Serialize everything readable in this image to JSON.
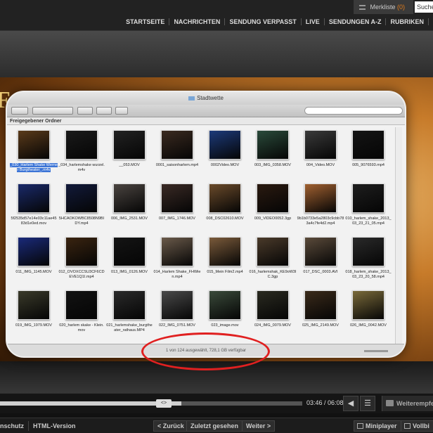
{
  "topbar": {
    "merkliste_label": "Merkliste",
    "merkliste_count": "(0)",
    "search_text": "Suche",
    "nav": [
      "STARTSEITE",
      "NACHRICHTEN",
      "SENDUNG VERPASST",
      "LIVE",
      "SENDUNGEN A-Z",
      "RUBRIKEN",
      "TI"
    ]
  },
  "video": {
    "finder": {
      "title": "Stadtwette",
      "path": "Freigegebener Ordner",
      "files": [
        {
          "name": "_030_Harlem Shake Werner Burgtheater_.m4v",
          "selected": true,
          "color": "#5a3a1a"
        },
        {
          "name": "_034_harlemshake wurzel.m4v",
          "color": "#1a1a1a"
        },
        {
          "name": "__053.MOV",
          "color": "#222"
        },
        {
          "name": "0001_saisonharlem.mp4",
          "color": "#3a2a20"
        },
        {
          "name": "0002Video.MOV",
          "color": "#1c3a7a"
        },
        {
          "name": "003_IMG_0358.MOV",
          "color": "#2a4a3a"
        },
        {
          "name": "004_Video.MOV",
          "color": "#3a3a3a"
        },
        {
          "name": "005_9076593.mp4",
          "color": "#141414"
        },
        {
          "name": "5f2535d57e14e03c11ae4583d1e0ed.mov",
          "color": "#1a2a6a"
        },
        {
          "name": "5HCAOKOWBC8508N9BIDY.mp4",
          "color": "#121a3a"
        },
        {
          "name": "006_IMG_2531.MOV",
          "color": "#4a4440"
        },
        {
          "name": "007_IMG_1746.MOV",
          "color": "#3a2a25"
        },
        {
          "name": "008_DSC02610.MOV",
          "color": "#6a4a2a"
        },
        {
          "name": "009_VIDEO0052.3gp",
          "color": "#2a1a10"
        },
        {
          "name": "9b1b0733e5a2803c9cbb783a4c7fe4d2.mp4",
          "color": "#a06030"
        },
        {
          "name": "010_harlem_shake_2013_03_23_21_05.mp4",
          "color": "#1e1e1e"
        },
        {
          "name": "011_IMG_1145.MOV",
          "color": "#1a2a7a"
        },
        {
          "name": "012_OVOXCCSU3CF6CDEVE1Q1I.mp4",
          "color": "#3a2410"
        },
        {
          "name": "013_IMG_0126.MOV",
          "color": "#141414"
        },
        {
          "name": "014_Harlem Shake_FHWien.mp4",
          "color": "#6a5a4a"
        },
        {
          "name": "015_Mein Film2.mp4",
          "color": "#7a5a3a"
        },
        {
          "name": "016_harlemshak_KE9oW3IC.3gp",
          "color": "#4a3a2a"
        },
        {
          "name": "017_DSC_0003.AVI",
          "color": "#5a4a3a"
        },
        {
          "name": "018_harlem_shake_2013_03_23_20_58.mp4",
          "color": "#2a2a2a"
        },
        {
          "name": "019_IMG_1979.MOV",
          "color": "#3a3a2a"
        },
        {
          "name": "020_harlem skake - Klein.mov",
          "color": "#121212"
        },
        {
          "name": "021_harlemshake_burgtheater_rathaus.MP4",
          "color": "#2a2a2a"
        },
        {
          "name": "022_IMG_0751.MOV",
          "color": "#4a4a4a"
        },
        {
          "name": "023_image.mov",
          "color": "#3a4a3a"
        },
        {
          "name": "024_IMG_0079.MOV",
          "color": "#2a2a20"
        },
        {
          "name": "025_IMG_2149.MOV",
          "color": "#3a2a1a"
        },
        {
          "name": "026_IMG_0042.MOV",
          "color": "#7a6a3a"
        }
      ],
      "status": "1 von 124 ausgewählt, 728,1 GB verfügbar"
    }
  },
  "controls": {
    "progress": 0.6,
    "knob_label": "<>",
    "time": "03:46 / 06:08",
    "weiter_label": "Weiterempfehlen"
  },
  "bottombar": {
    "left_partial": "nschutz",
    "html_version": "HTML-Version",
    "back": "< Zurück",
    "recent": "Zuletzt gesehen",
    "next": "Weiter >",
    "miniplayer": "Miniplayer",
    "fullscreen": "Vollbi"
  },
  "colors": {
    "accent": "#e07b1a",
    "highlight_ring": "#e02020"
  }
}
